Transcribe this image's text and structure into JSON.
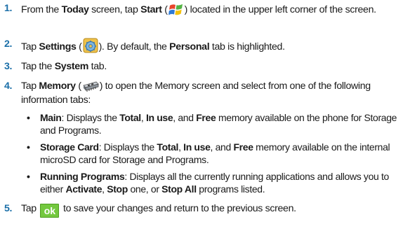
{
  "steps": [
    {
      "num": "1.",
      "t1": "From the ",
      "b1": "Today",
      "t2": " screen, tap ",
      "b2": "Start",
      "t3": " (",
      "t4": ") located in the upper left corner of the screen."
    },
    {
      "num": "2.",
      "t1": "Tap ",
      "b1": "Settings",
      "t2": " (",
      "t3": "). By default, the ",
      "b2": "Personal",
      "t4": " tab is highlighted."
    },
    {
      "num": "3.",
      "t1": "Tap the ",
      "b1": "System",
      "t2": " tab."
    },
    {
      "num": "4.",
      "t1": "Tap ",
      "b1": "Memory",
      "t2": " (",
      "t3": ") to open the Memory screen and select from one of the following information tabs:"
    },
    {
      "num": "5.",
      "t1": "Tap ",
      "ok": "ok",
      "t2": " to save your changes and return to the previous screen."
    }
  ],
  "bullets": [
    {
      "dot": "•",
      "b1": "Main",
      "t1": ": Displays the ",
      "b2": "Total",
      "t2": ", ",
      "b3": "In use",
      "t3": ", and ",
      "b4": "Free",
      "t4": " memory available on the phone for Storage and Programs."
    },
    {
      "dot": "•",
      "b1": "Storage Card",
      "t1": ": Displays the ",
      "b2": "Total",
      "t2": ", ",
      "b3": "In use",
      "t3": ", and ",
      "b4": "Free",
      "t4": " memory available on the internal microSD card for Storage and Programs."
    },
    {
      "dot": "•",
      "b1": "Running Programs",
      "t1": ": Displays all the currently running applications and allows you to either ",
      "b2": "Activate",
      "t2": ", ",
      "b3": "Stop",
      "t3": " one, or ",
      "b4": "Stop All",
      "t4": " programs listed."
    }
  ],
  "icons": {
    "start": "windows-start-icon",
    "settings": "settings-icon",
    "memory": "memory-icon",
    "ok_color": "#73c83e"
  }
}
